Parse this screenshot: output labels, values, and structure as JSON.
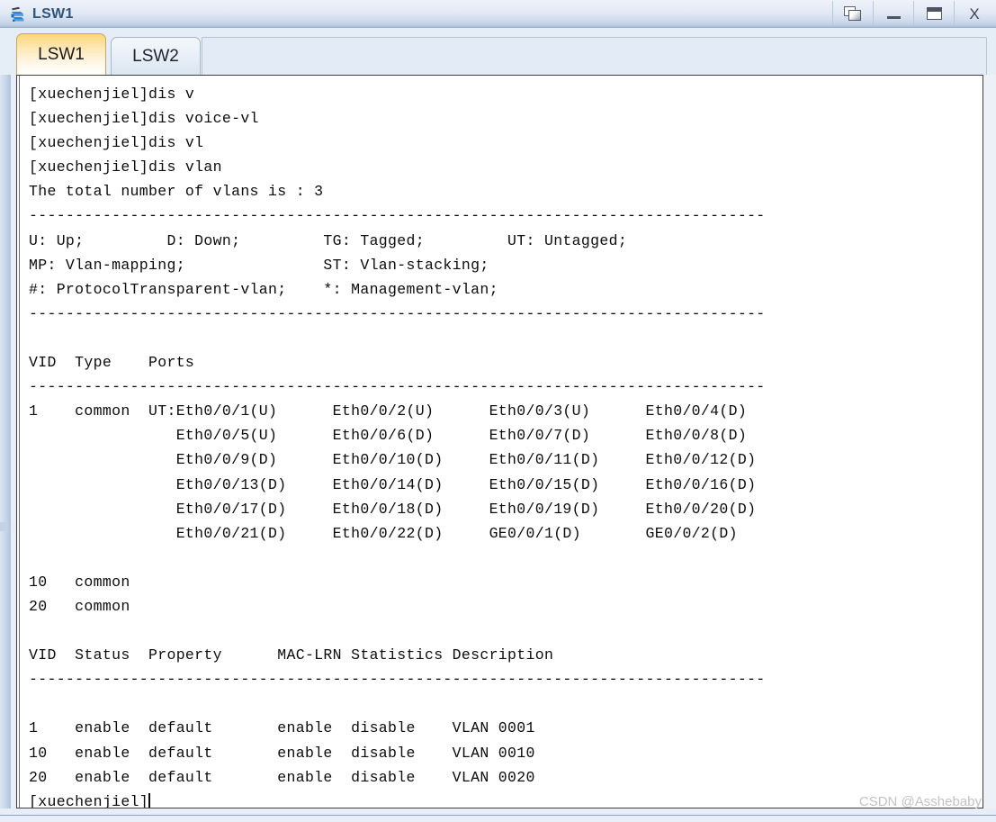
{
  "window": {
    "title": "LSW1",
    "icon": "switch-icon",
    "buttons": {
      "restore": "restore-window",
      "minimize": "minimize-window",
      "maximize": "maximize-window",
      "close": "X"
    }
  },
  "tabs": [
    {
      "label": "LSW1",
      "active": true
    },
    {
      "label": "LSW2",
      "active": false
    }
  ],
  "terminal": {
    "prompt": "[xuechenjiel]",
    "lines": [
      "[xuechenjiel]dis v",
      "[xuechenjiel]dis voice-vl",
      "[xuechenjiel]dis vl",
      "[xuechenjiel]dis vlan",
      "The total number of vlans is : 3",
      "--------------------------------------------------------------------------------",
      "U: Up;         D: Down;         TG: Tagged;         UT: Untagged;",
      "MP: Vlan-mapping;               ST: Vlan-stacking;",
      "#: ProtocolTransparent-vlan;    *: Management-vlan;",
      "--------------------------------------------------------------------------------",
      "",
      "VID  Type    Ports",
      "--------------------------------------------------------------------------------",
      "1    common  UT:Eth0/0/1(U)      Eth0/0/2(U)      Eth0/0/3(U)      Eth0/0/4(D)",
      "                Eth0/0/5(U)      Eth0/0/6(D)      Eth0/0/7(D)      Eth0/0/8(D)",
      "                Eth0/0/9(D)      Eth0/0/10(D)     Eth0/0/11(D)     Eth0/0/12(D)",
      "                Eth0/0/13(D)     Eth0/0/14(D)     Eth0/0/15(D)     Eth0/0/16(D)",
      "                Eth0/0/17(D)     Eth0/0/18(D)     Eth0/0/19(D)     Eth0/0/20(D)",
      "                Eth0/0/21(D)     Eth0/0/22(D)     GE0/0/1(D)       GE0/0/2(D)",
      "",
      "10   common",
      "20   common",
      "",
      "VID  Status  Property      MAC-LRN Statistics Description",
      "--------------------------------------------------------------------------------",
      "",
      "1    enable  default       enable  disable    VLAN 0001",
      "10   enable  default       enable  disable    VLAN 0010",
      "20   enable  default       enable  disable    VLAN 0020"
    ],
    "last_line": "[xuechenjiel]"
  },
  "vlan_summary": {
    "total_vlans": 3,
    "legend": [
      {
        "code": "U",
        "meaning": "Up"
      },
      {
        "code": "D",
        "meaning": "Down"
      },
      {
        "code": "TG",
        "meaning": "Tagged"
      },
      {
        "code": "UT",
        "meaning": "Untagged"
      },
      {
        "code": "MP",
        "meaning": "Vlan-mapping"
      },
      {
        "code": "ST",
        "meaning": "Vlan-stacking"
      },
      {
        "code": "#",
        "meaning": "ProtocolTransparent-vlan"
      },
      {
        "code": "*",
        "meaning": "Management-vlan"
      }
    ],
    "ports_table": {
      "headers": [
        "VID",
        "Type",
        "Ports"
      ],
      "rows": [
        {
          "vid": "1",
          "type": "common",
          "ports": [
            "UT:Eth0/0/1(U)",
            "Eth0/0/2(U)",
            "Eth0/0/3(U)",
            "Eth0/0/4(D)",
            "Eth0/0/5(U)",
            "Eth0/0/6(D)",
            "Eth0/0/7(D)",
            "Eth0/0/8(D)",
            "Eth0/0/9(D)",
            "Eth0/0/10(D)",
            "Eth0/0/11(D)",
            "Eth0/0/12(D)",
            "Eth0/0/13(D)",
            "Eth0/0/14(D)",
            "Eth0/0/15(D)",
            "Eth0/0/16(D)",
            "Eth0/0/17(D)",
            "Eth0/0/18(D)",
            "Eth0/0/19(D)",
            "Eth0/0/20(D)",
            "Eth0/0/21(D)",
            "Eth0/0/22(D)",
            "GE0/0/1(D)",
            "GE0/0/2(D)"
          ]
        },
        {
          "vid": "10",
          "type": "common",
          "ports": []
        },
        {
          "vid": "20",
          "type": "common",
          "ports": []
        }
      ]
    },
    "status_table": {
      "headers": [
        "VID",
        "Status",
        "Property",
        "MAC-LRN",
        "Statistics",
        "Description"
      ],
      "rows": [
        [
          "1",
          "enable",
          "default",
          "enable",
          "disable",
          "VLAN 0001"
        ],
        [
          "10",
          "enable",
          "default",
          "enable",
          "disable",
          "VLAN 0010"
        ],
        [
          "20",
          "enable",
          "default",
          "enable",
          "disable",
          "VLAN 0020"
        ]
      ]
    }
  },
  "watermark": "CSDN @Asshebaby",
  "colors": {
    "titlebar_top": "#eef3fa",
    "titlebar_bottom": "#a8bdd4",
    "active_tab": "#fbd77a",
    "inactive_tab": "#e6eef7",
    "terminal_bg": "#ffffff",
    "terminal_text": "#0c0c0c",
    "title_text": "#31547d",
    "watermark": "#c2c2c2"
  }
}
